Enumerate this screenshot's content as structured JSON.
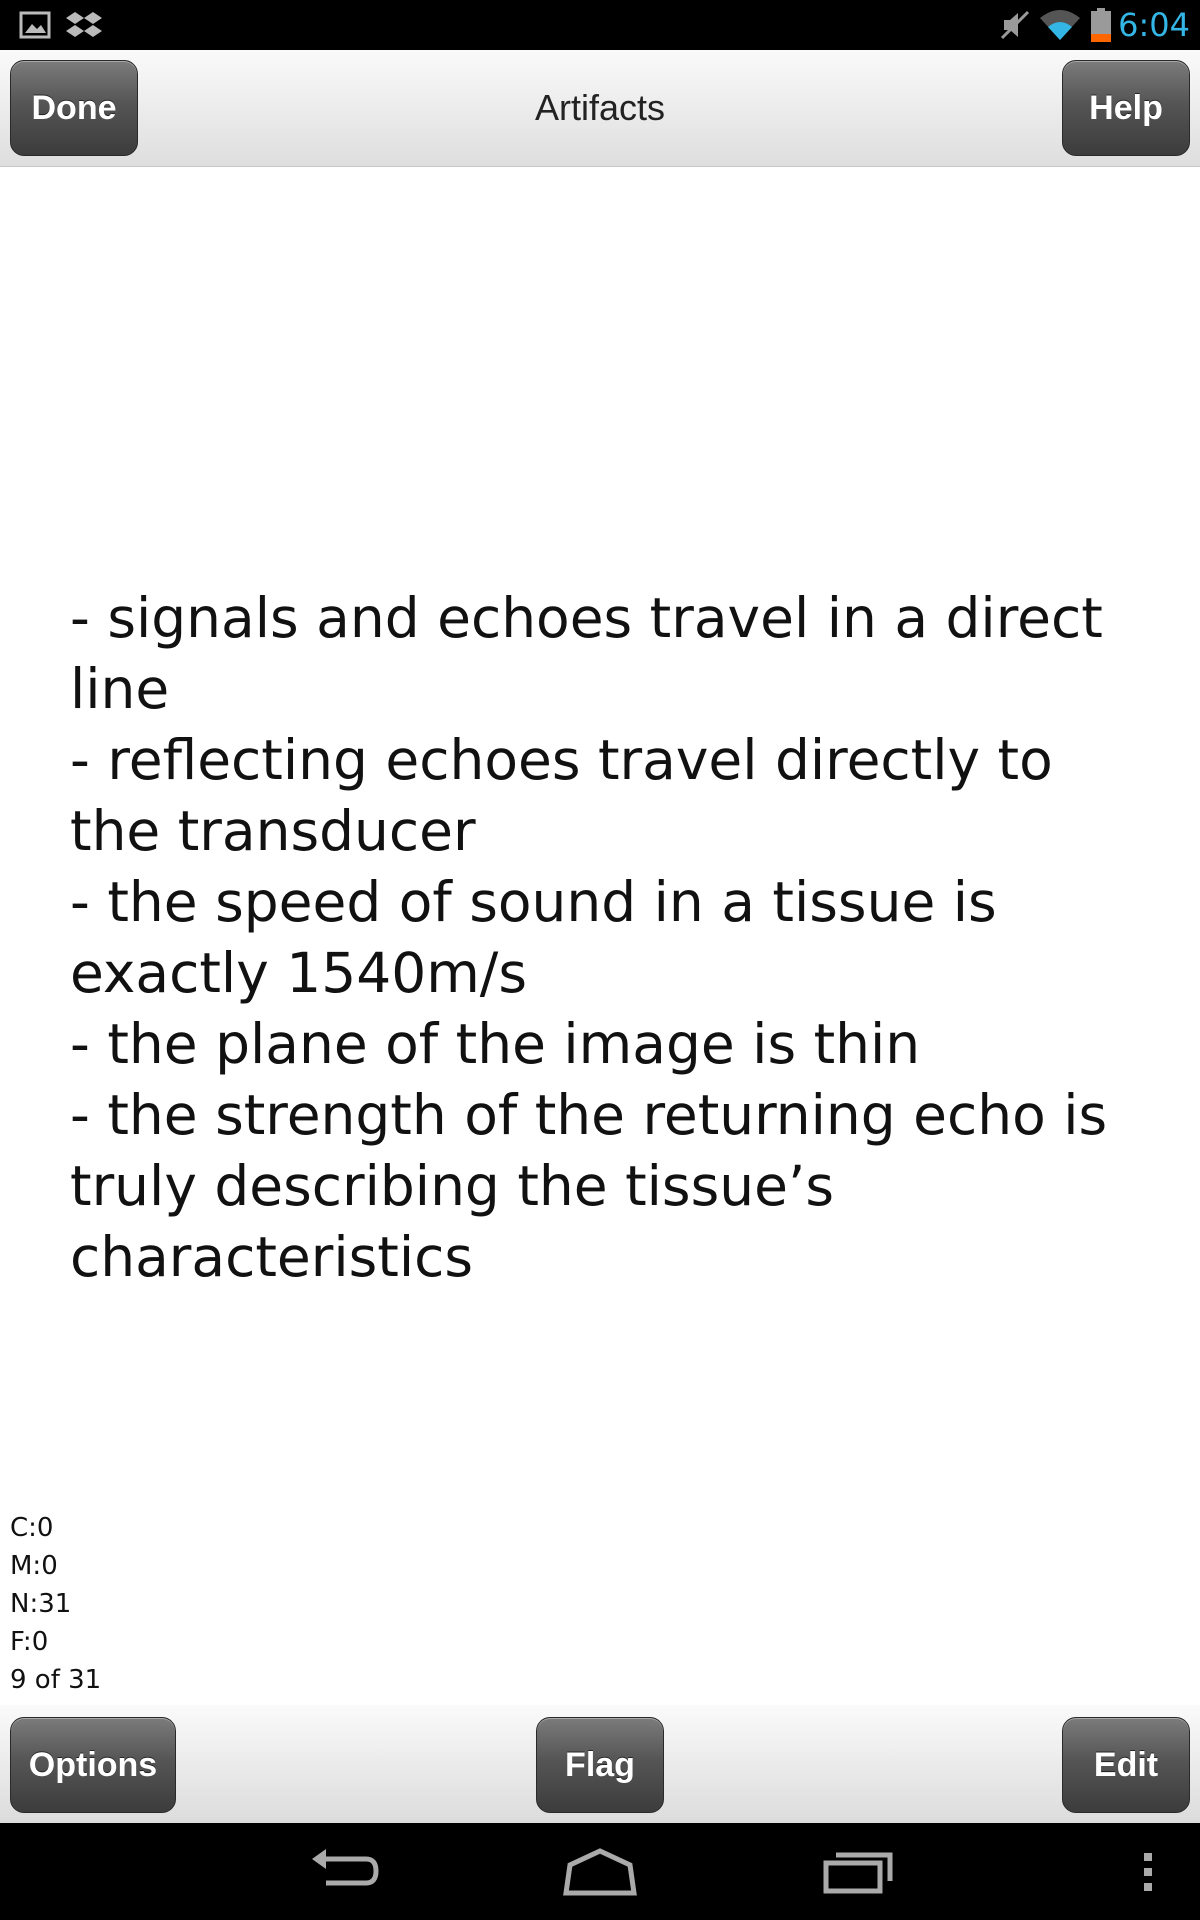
{
  "status_bar": {
    "time": "6:04",
    "icons": [
      "gallery-icon",
      "dropbox-icon",
      "muted-icon",
      "wifi-icon",
      "battery-icon"
    ]
  },
  "header": {
    "title": "Artifacts",
    "done_label": "Done",
    "help_label": "Help"
  },
  "card": {
    "lines": [
      "- signals and echoes travel in a direct line",
      "- reflecting echoes travel directly to the transducer",
      "- the speed of sound in a tissue is exactly 1540m/s",
      "- the plane of the image is thin",
      "- the strength of the returning echo is truly describing the tissue’s characteristics"
    ]
  },
  "stats": {
    "correct": "C:0",
    "missed": "M:0",
    "new": "N:31",
    "flagged": "F:0",
    "position": "9 of 31"
  },
  "footer": {
    "options_label": "Options",
    "flag_label": "Flag",
    "edit_label": "Edit"
  },
  "nav": {
    "icons": [
      "back-icon",
      "home-icon",
      "recent-apps-icon",
      "overflow-menu-icon"
    ]
  },
  "colors": {
    "status_bar_bg": "#000000",
    "clock": "#33b5e5",
    "button_dark": "#4a4a4a",
    "toolbar_light": "#eeeeee",
    "battery_low": "#ff6600"
  }
}
